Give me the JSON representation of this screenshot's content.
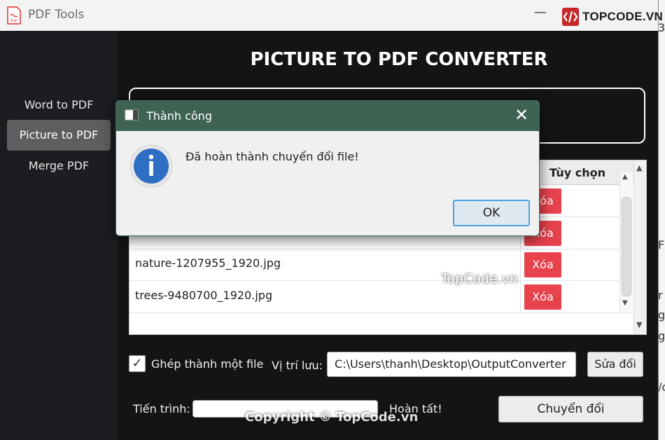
{
  "app": {
    "title": "PDF Tools",
    "brand": "TOPCODE.VN"
  },
  "sidebar": {
    "items": [
      {
        "label": "Word to PDF",
        "active": false
      },
      {
        "label": "Picture to PDF",
        "active": true
      },
      {
        "label": "Merge PDF",
        "active": false
      }
    ]
  },
  "main": {
    "heading": "PICTURE TO PDF CONVERTER",
    "table": {
      "columns": [
        "Tùy chọn"
      ],
      "rows": [
        {
          "name": "",
          "action": "Xóa"
        },
        {
          "name": "",
          "action": "Xóa"
        },
        {
          "name": "nature-1207955_1920.jpg",
          "action": "Xóa"
        },
        {
          "name": "trees-9480700_1920.jpg",
          "action": "Xóa"
        }
      ]
    },
    "merge": {
      "label": "Ghép thành một file",
      "checked": true
    },
    "save": {
      "label": "Vị trí lưu:",
      "path": "C:\\Users\\thanh\\Desktop\\OutputConverter",
      "change_label": "Sửa đổi"
    },
    "progress": {
      "label": "Tiến trình:",
      "value": 0,
      "status": "Hoàn tất!"
    },
    "convert_label": "Chuyển đổi"
  },
  "dialog": {
    "title": "Thành công",
    "message": "Đã hoàn thành chuyển đổi file!",
    "ok_label": "OK"
  },
  "watermarks": {
    "center": "TopCode.vn",
    "bottom": "Copyright © TopCode.vn"
  },
  "background_window": {
    "fragments": [
      "3",
      "F",
      "r",
      "gi",
      "g",
      "/c"
    ]
  },
  "colors": {
    "delete_button": "#e8424d",
    "dialog_titlebar": "#3e6353",
    "sidebar_active": "#5d5e60",
    "info_icon": "#2e6fc4"
  }
}
